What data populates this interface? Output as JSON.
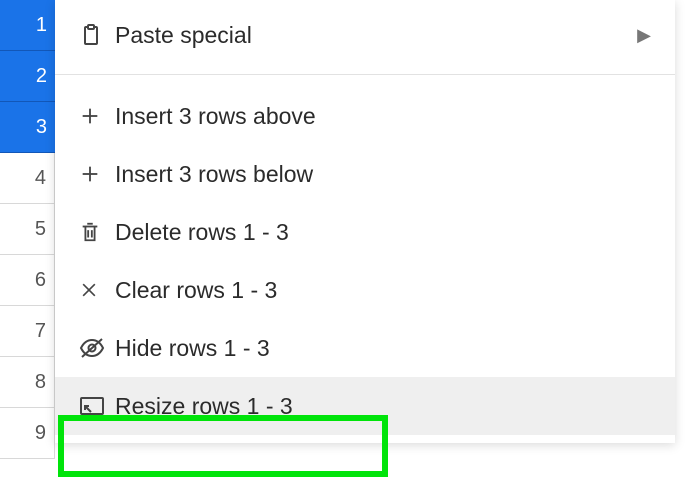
{
  "rows": {
    "r1": "1",
    "r2": "2",
    "r3": "3",
    "r4": "4",
    "r5": "5",
    "r6": "6",
    "r7": "7",
    "r8": "8",
    "r9": "9"
  },
  "menu": {
    "paste_special": "Paste special",
    "insert_above": "Insert 3 rows above",
    "insert_below": "Insert 3 rows below",
    "delete": "Delete rows 1 - 3",
    "clear": "Clear rows 1 - 3",
    "hide": "Hide rows 1 - 3",
    "resize": "Resize rows 1 - 3"
  }
}
